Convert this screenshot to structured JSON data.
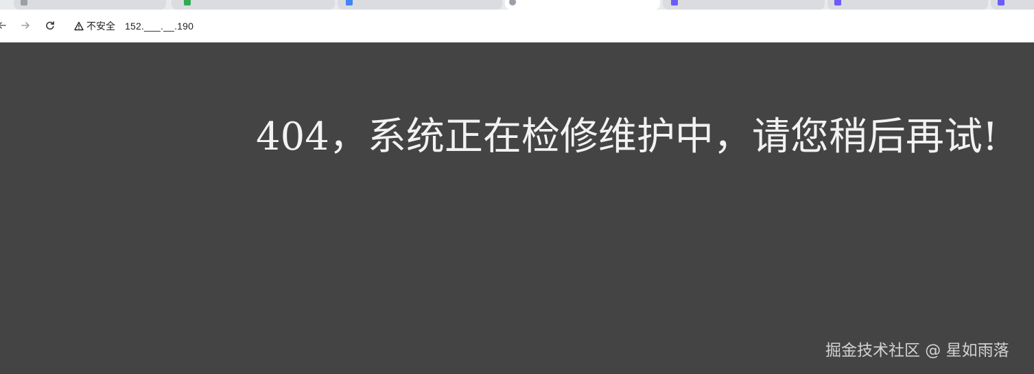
{
  "browser": {
    "security_label": "不安全",
    "address": "152.___.__.190",
    "tabs": [
      {
        "favicon_color": "#9aa0a6",
        "active": false
      },
      {
        "favicon_color": "#34a853",
        "active": false
      },
      {
        "favicon_color": "#4285f4",
        "active": false
      },
      {
        "favicon_color": "#9aa0a6",
        "active": true
      },
      {
        "favicon_color": "#6b5cf6",
        "active": false
      },
      {
        "favicon_color": "#6b5cf6",
        "active": false
      },
      {
        "favicon_color": "#6b5cf6",
        "active": false
      }
    ],
    "icons": {
      "back": "arrow-left-icon",
      "forward": "arrow-right-icon",
      "reload": "reload-icon",
      "security": "warning-triangle-icon"
    }
  },
  "page": {
    "message": "404，系统正在检修维护中，请您稍后再试!",
    "background_color": "#444444",
    "text_color": "#f2f2f2"
  },
  "watermark": {
    "text": "掘金技术社区 @ 星如雨落"
  }
}
